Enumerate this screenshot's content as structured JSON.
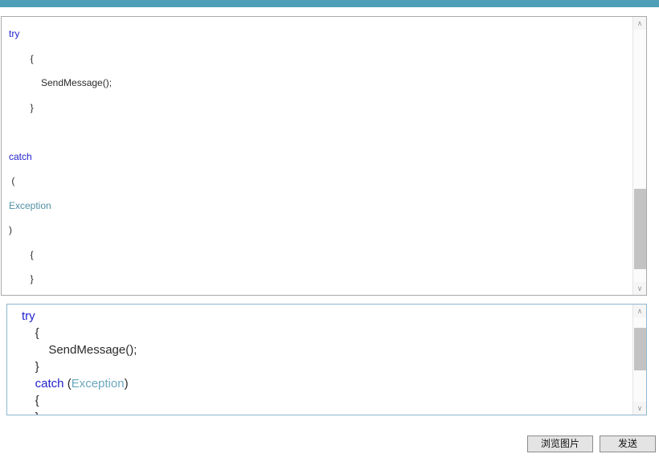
{
  "theme": {
    "accent_bar_color": "#4f9fb8",
    "keyword_color": "#2222cc",
    "type_color": "#4f90a6",
    "preview_border_color": "#8fb6cf",
    "editor_border_color": "#a9a9a9",
    "button_face_color": "#e4e4e4"
  },
  "editor": {
    "name": "code-input-area",
    "lines": [
      {
        "segments": [
          {
            "text": "try",
            "style": "kw"
          }
        ]
      },
      {
        "segments": [
          {
            "text": "        {",
            "style": "punc"
          }
        ]
      },
      {
        "segments": [
          {
            "text": "            SendMessage();",
            "style": "punc"
          }
        ]
      },
      {
        "segments": [
          {
            "text": "        }",
            "style": "punc"
          }
        ]
      },
      {
        "segments": [
          {
            "text": "",
            "style": "punc"
          }
        ]
      },
      {
        "segments": [
          {
            "text": "catch",
            "style": "kw"
          }
        ]
      },
      {
        "segments": [
          {
            "text": " (",
            "style": "punc"
          }
        ]
      },
      {
        "segments": [
          {
            "text": "Exception",
            "style": "type"
          }
        ]
      },
      {
        "segments": [
          {
            "text": ")",
            "style": "punc"
          }
        ]
      },
      {
        "segments": [
          {
            "text": "        {",
            "style": "punc"
          }
        ]
      },
      {
        "segments": [
          {
            "text": "        }",
            "style": "punc"
          }
        ]
      }
    ],
    "scrollbar": {
      "up_arrow_glyph": "∧",
      "down_arrow_glyph": "∨",
      "thumb_top_pct": 63,
      "thumb_height_pct": 32
    }
  },
  "preview": {
    "name": "code-preview-area",
    "lines": [
      {
        "segments": [
          {
            "text": "try",
            "style": "kw"
          }
        ]
      },
      {
        "segments": [
          {
            "text": "    {",
            "style": "punc"
          }
        ]
      },
      {
        "segments": [
          {
            "text": "        SendMessage();",
            "style": "punc"
          }
        ]
      },
      {
        "segments": [
          {
            "text": "    }",
            "style": "punc"
          }
        ]
      },
      {
        "segments": [
          {
            "text": "    ",
            "style": "punc"
          },
          {
            "text": "catch",
            "style": "kw"
          },
          {
            "text": " (",
            "style": "punc"
          },
          {
            "text": "Exception",
            "style": "type"
          },
          {
            "text": ")",
            "style": "punc"
          }
        ]
      },
      {
        "segments": [
          {
            "text": "    {",
            "style": "punc"
          }
        ]
      },
      {
        "segments": [
          {
            "text": "    }",
            "style": "punc"
          }
        ]
      }
    ],
    "scrollbar": {
      "up_arrow_glyph": "∧",
      "down_arrow_glyph": "∨",
      "thumb_top_pct": 12,
      "thumb_height_pct": 50
    }
  },
  "buttons": {
    "browse_label": "浏览图片",
    "send_label": "发送"
  }
}
